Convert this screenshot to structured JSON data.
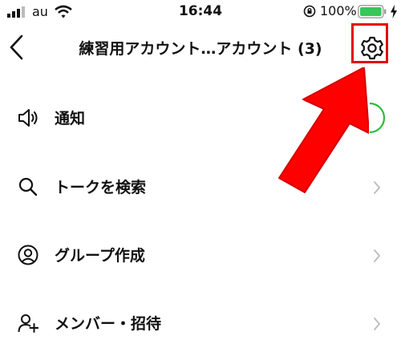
{
  "status_bar": {
    "carrier": "au",
    "time": "16:44",
    "battery_percent": "100%"
  },
  "header": {
    "title": "練習用アカウント…アカウント (3)",
    "back_icon": "chevron-left-icon",
    "settings_icon": "gear-icon"
  },
  "menu": {
    "items": [
      {
        "label": "通知",
        "icon": "speaker-icon",
        "control": "toggle",
        "toggle_on": true
      },
      {
        "label": "トークを検索",
        "icon": "search-icon",
        "control": "chevron"
      },
      {
        "label": "グループ作成",
        "icon": "user-circle-icon",
        "control": "chevron"
      },
      {
        "label": "メンバー・招待",
        "icon": "add-user-icon",
        "control": "chevron"
      }
    ]
  },
  "colors": {
    "highlight": "#e60012",
    "toggle_on": "#2dbb3a",
    "battery": "#35c759"
  }
}
